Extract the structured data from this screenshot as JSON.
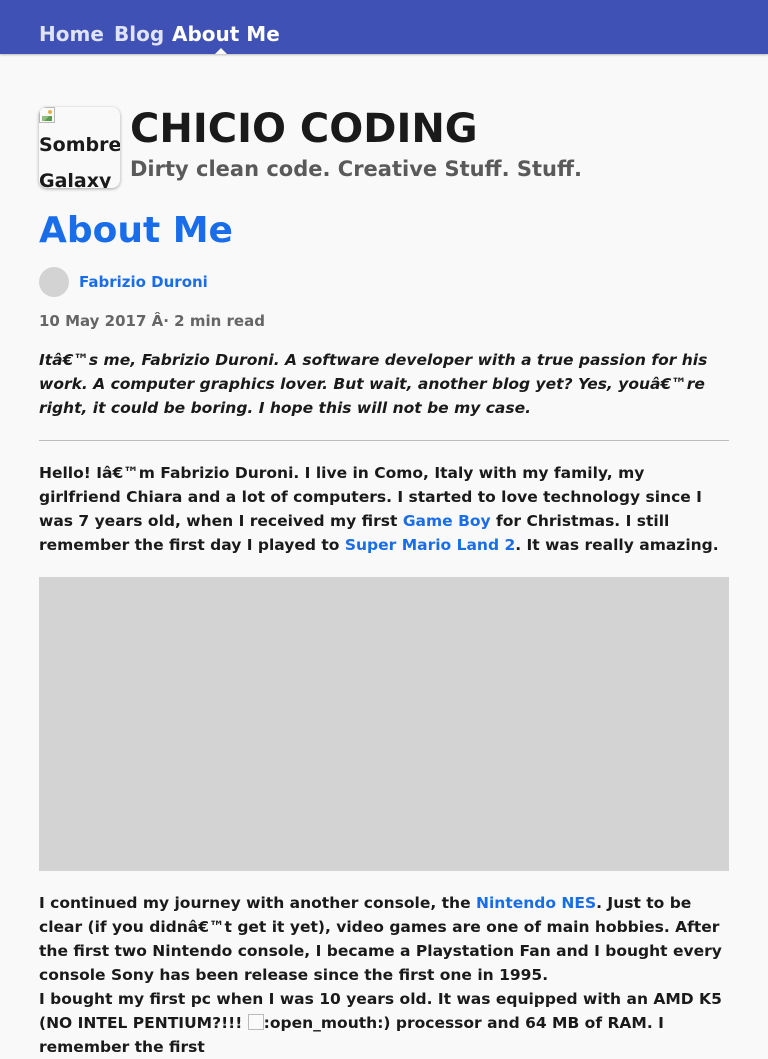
{
  "nav": {
    "items": [
      {
        "label": "Home",
        "active": false
      },
      {
        "label": "Blog",
        "active": false
      },
      {
        "label": "About Me",
        "active": true
      }
    ]
  },
  "header": {
    "logo_alt": "Sombrero Galaxy",
    "title": "CHICIO CODING",
    "tagline": "Dirty clean code. Creative Stuff. Stuff."
  },
  "post": {
    "title": "About Me",
    "author": "Fabrizio Duroni",
    "meta": "10 May 2017 Â· 2 min read",
    "description": "Itâ€™s me, Fabrizio Duroni. A software developer with a true passion for his work. A computer graphics lover. But wait, another blog yet? Yes, youâ€™re right, it could be boring. I hope this will not be my case.",
    "p1": {
      "t1": "Hello! Iâ€™m Fabrizio Duroni. I live in Como, Italy with my family, my girlfriend Chiara and a lot of computers. I started to love technology since I was 7 years old, when I received my first ",
      "link1": "Game Boy",
      "t2": " for Christmas. I still remember the first day I played to ",
      "link2": "Super Mario Land 2",
      "t3": ". It was really amazing."
    },
    "p2": {
      "t1": "I continued my journey with another console, the ",
      "link1": "Nintendo NES",
      "t2": ". Just to be clear (if you didnâ€™t get it yet), video games are one of main hobbies. After the first two Nintendo console, I became a Playstation Fan and I bought every console Sony has been release since the first one in 1995."
    },
    "p3": {
      "t1": "I bought my first pc when I was 10 years old. It was equipped with an AMD K5 (NO INTEL PENTIUM?!!! ",
      "emoji_alt": ":open_mouth:",
      "t2": ") processor and 64 MB of RAM. I remember the first"
    }
  },
  "colors": {
    "nav_bg": "#3f51b5",
    "link": "#1a6de8",
    "placeholder": "#d3d3d3"
  }
}
